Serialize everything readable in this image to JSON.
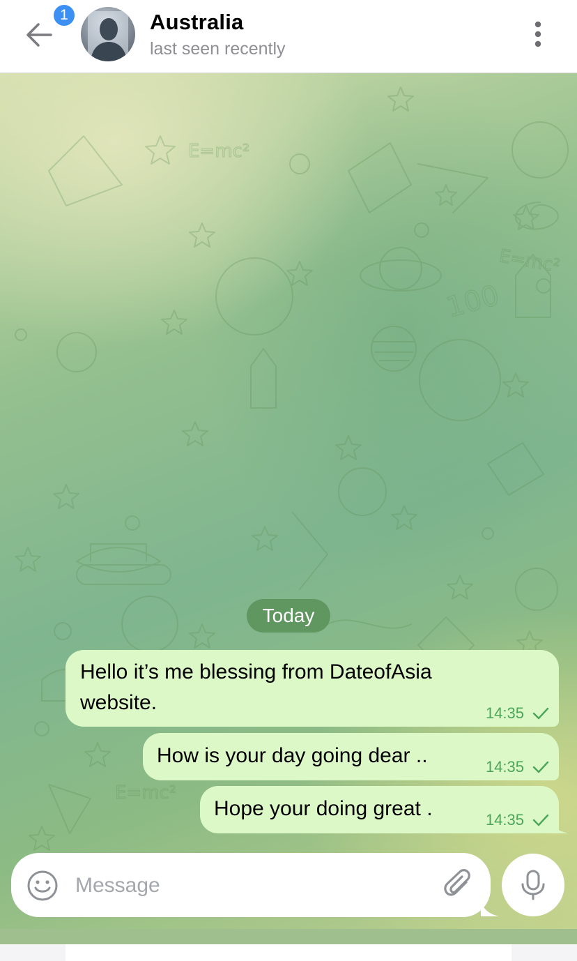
{
  "header": {
    "unread_badge": "1",
    "contact_name": "Australia",
    "status": "last seen recently"
  },
  "chat": {
    "date_separator": "Today",
    "messages": [
      {
        "line1": "Hello it’s me blessing from DateofAsia",
        "line2": "website.",
        "time": "14:35",
        "status": "sent"
      },
      {
        "text": "How is your day going dear ..",
        "time": "14:35",
        "status": "sent"
      },
      {
        "text": "Hope your doing great .",
        "time": "14:35",
        "status": "sent"
      }
    ]
  },
  "composer": {
    "placeholder": "Message"
  },
  "icons": {
    "back": "back-arrow-icon",
    "more": "more-vertical-icon",
    "emoji": "emoji-icon",
    "attach": "paperclip-icon",
    "mic": "microphone-icon",
    "check": "single-check-icon"
  },
  "colors": {
    "accent": "#3c8ff3",
    "bubble_outgoing": "#dcf8c6",
    "time_text": "#4ba65a",
    "date_pill": "#548c52"
  }
}
